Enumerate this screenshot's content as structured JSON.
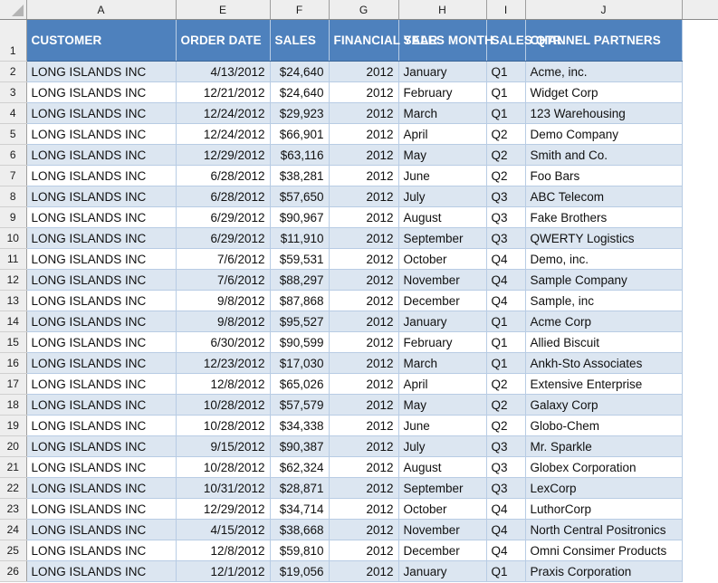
{
  "app": {
    "type": "spreadsheet",
    "select_all_icon": "select-all-triangle-icon"
  },
  "colors": {
    "header_fill": "#4e81bd",
    "header_text": "#ffffff",
    "band_fill": "#dce6f1",
    "plain_fill": "#ffffff",
    "cell_border": "#b8cce4",
    "gutter_fill": "#eeeeee"
  },
  "columns": {
    "letters": [
      "A",
      "E",
      "F",
      "G",
      "H",
      "I",
      "J"
    ],
    "headers": [
      "CUSTOMER",
      "ORDER DATE",
      "SALES",
      "FINANCIAL YEAR",
      "SALES MONTH",
      "SALES QTR",
      "CHANNEL PARTNERS"
    ]
  },
  "row_numbers": [
    "1",
    "2",
    "3",
    "4",
    "5",
    "6",
    "7",
    "8",
    "9",
    "10",
    "11",
    "12",
    "13",
    "14",
    "15",
    "16",
    "17",
    "18",
    "19",
    "20",
    "21",
    "22",
    "23",
    "24",
    "25",
    "26"
  ],
  "rows": [
    {
      "n": "2",
      "customer": "LONG ISLANDS INC",
      "order_date": "4/13/2012",
      "sales": "$24,640",
      "financial_year": "2012",
      "sales_month": "January",
      "sales_qtr": "Q1",
      "channel_partner": "Acme, inc."
    },
    {
      "n": "3",
      "customer": "LONG ISLANDS INC",
      "order_date": "12/21/2012",
      "sales": "$24,640",
      "financial_year": "2012",
      "sales_month": "February",
      "sales_qtr": "Q1",
      "channel_partner": "Widget Corp"
    },
    {
      "n": "4",
      "customer": "LONG ISLANDS INC",
      "order_date": "12/24/2012",
      "sales": "$29,923",
      "financial_year": "2012",
      "sales_month": "March",
      "sales_qtr": "Q1",
      "channel_partner": "123 Warehousing"
    },
    {
      "n": "5",
      "customer": "LONG ISLANDS INC",
      "order_date": "12/24/2012",
      "sales": "$66,901",
      "financial_year": "2012",
      "sales_month": "April",
      "sales_qtr": "Q2",
      "channel_partner": "Demo Company"
    },
    {
      "n": "6",
      "customer": "LONG ISLANDS INC",
      "order_date": "12/29/2012",
      "sales": "$63,116",
      "financial_year": "2012",
      "sales_month": "May",
      "sales_qtr": "Q2",
      "channel_partner": "Smith and Co."
    },
    {
      "n": "7",
      "customer": "LONG ISLANDS INC",
      "order_date": "6/28/2012",
      "sales": "$38,281",
      "financial_year": "2012",
      "sales_month": "June",
      "sales_qtr": "Q2",
      "channel_partner": "Foo Bars"
    },
    {
      "n": "8",
      "customer": "LONG ISLANDS INC",
      "order_date": "6/28/2012",
      "sales": "$57,650",
      "financial_year": "2012",
      "sales_month": "July",
      "sales_qtr": "Q3",
      "channel_partner": "ABC Telecom"
    },
    {
      "n": "9",
      "customer": "LONG ISLANDS INC",
      "order_date": "6/29/2012",
      "sales": "$90,967",
      "financial_year": "2012",
      "sales_month": "August",
      "sales_qtr": "Q3",
      "channel_partner": "Fake Brothers"
    },
    {
      "n": "10",
      "customer": "LONG ISLANDS INC",
      "order_date": "6/29/2012",
      "sales": "$11,910",
      "financial_year": "2012",
      "sales_month": "September",
      "sales_qtr": "Q3",
      "channel_partner": "QWERTY Logistics"
    },
    {
      "n": "11",
      "customer": "LONG ISLANDS INC",
      "order_date": "7/6/2012",
      "sales": "$59,531",
      "financial_year": "2012",
      "sales_month": "October",
      "sales_qtr": "Q4",
      "channel_partner": "Demo, inc."
    },
    {
      "n": "12",
      "customer": "LONG ISLANDS INC",
      "order_date": "7/6/2012",
      "sales": "$88,297",
      "financial_year": "2012",
      "sales_month": "November",
      "sales_qtr": "Q4",
      "channel_partner": "Sample Company"
    },
    {
      "n": "13",
      "customer": "LONG ISLANDS INC",
      "order_date": "9/8/2012",
      "sales": "$87,868",
      "financial_year": "2012",
      "sales_month": "December",
      "sales_qtr": "Q4",
      "channel_partner": "Sample, inc"
    },
    {
      "n": "14",
      "customer": "LONG ISLANDS INC",
      "order_date": "9/8/2012",
      "sales": "$95,527",
      "financial_year": "2012",
      "sales_month": "January",
      "sales_qtr": "Q1",
      "channel_partner": "Acme Corp"
    },
    {
      "n": "15",
      "customer": "LONG ISLANDS INC",
      "order_date": "6/30/2012",
      "sales": "$90,599",
      "financial_year": "2012",
      "sales_month": "February",
      "sales_qtr": "Q1",
      "channel_partner": "Allied Biscuit"
    },
    {
      "n": "16",
      "customer": "LONG ISLANDS INC",
      "order_date": "12/23/2012",
      "sales": "$17,030",
      "financial_year": "2012",
      "sales_month": "March",
      "sales_qtr": "Q1",
      "channel_partner": "Ankh-Sto Associates"
    },
    {
      "n": "17",
      "customer": "LONG ISLANDS INC",
      "order_date": "12/8/2012",
      "sales": "$65,026",
      "financial_year": "2012",
      "sales_month": "April",
      "sales_qtr": "Q2",
      "channel_partner": "Extensive Enterprise"
    },
    {
      "n": "18",
      "customer": "LONG ISLANDS INC",
      "order_date": "10/28/2012",
      "sales": "$57,579",
      "financial_year": "2012",
      "sales_month": "May",
      "sales_qtr": "Q2",
      "channel_partner": "Galaxy Corp"
    },
    {
      "n": "19",
      "customer": "LONG ISLANDS INC",
      "order_date": "10/28/2012",
      "sales": "$34,338",
      "financial_year": "2012",
      "sales_month": "June",
      "sales_qtr": "Q2",
      "channel_partner": "Globo-Chem"
    },
    {
      "n": "20",
      "customer": "LONG ISLANDS INC",
      "order_date": "9/15/2012",
      "sales": "$90,387",
      "financial_year": "2012",
      "sales_month": "July",
      "sales_qtr": "Q3",
      "channel_partner": "Mr. Sparkle"
    },
    {
      "n": "21",
      "customer": "LONG ISLANDS INC",
      "order_date": "10/28/2012",
      "sales": "$62,324",
      "financial_year": "2012",
      "sales_month": "August",
      "sales_qtr": "Q3",
      "channel_partner": "Globex Corporation"
    },
    {
      "n": "22",
      "customer": "LONG ISLANDS INC",
      "order_date": "10/31/2012",
      "sales": "$28,871",
      "financial_year": "2012",
      "sales_month": "September",
      "sales_qtr": "Q3",
      "channel_partner": "LexCorp"
    },
    {
      "n": "23",
      "customer": "LONG ISLANDS INC",
      "order_date": "12/29/2012",
      "sales": "$34,714",
      "financial_year": "2012",
      "sales_month": "October",
      "sales_qtr": "Q4",
      "channel_partner": "LuthorCorp"
    },
    {
      "n": "24",
      "customer": "LONG ISLANDS INC",
      "order_date": "4/15/2012",
      "sales": "$38,668",
      "financial_year": "2012",
      "sales_month": "November",
      "sales_qtr": "Q4",
      "channel_partner": "North Central Positronics"
    },
    {
      "n": "25",
      "customer": "LONG ISLANDS INC",
      "order_date": "12/8/2012",
      "sales": "$59,810",
      "financial_year": "2012",
      "sales_month": "December",
      "sales_qtr": "Q4",
      "channel_partner": "Omni Consimer Products"
    },
    {
      "n": "26",
      "customer": "LONG ISLANDS INC",
      "order_date": "12/1/2012",
      "sales": "$19,056",
      "financial_year": "2012",
      "sales_month": "January",
      "sales_qtr": "Q1",
      "channel_partner": "Praxis Corporation"
    }
  ]
}
